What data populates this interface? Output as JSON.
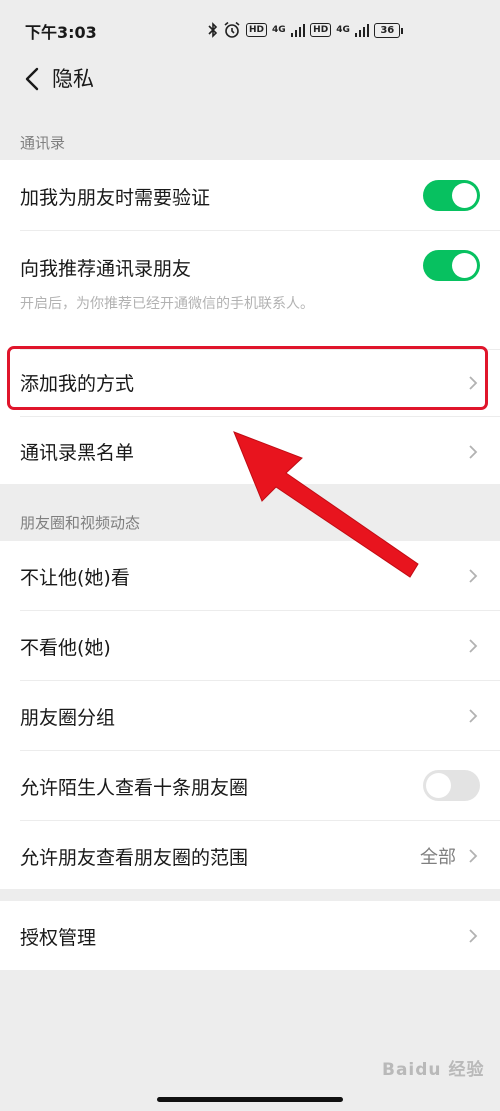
{
  "status_bar": {
    "time": "下午3:03",
    "hd1": "HD",
    "net1": "4G",
    "hd2": "HD",
    "net2": "4G",
    "battery": "36"
  },
  "nav": {
    "title": "隐私"
  },
  "sections": {
    "contacts": {
      "title": "通讯录"
    },
    "moments": {
      "title": "朋友圈和视频动态"
    }
  },
  "rows": {
    "verify": {
      "label": "加我为朋友时需要验证",
      "toggle_on": true
    },
    "recommend": {
      "label": "向我推荐通讯录朋友",
      "sub": "开启后，为你推荐已经开通微信的手机联系人。",
      "toggle_on": true
    },
    "add_methods": {
      "label": "添加我的方式"
    },
    "blacklist": {
      "label": "通讯录黑名单"
    },
    "hide_from": {
      "label": "不让他(她)看"
    },
    "dont_see": {
      "label": "不看他(她)"
    },
    "groups": {
      "label": "朋友圈分组"
    },
    "strangers": {
      "label": "允许陌生人查看十条朋友圈",
      "toggle_on": false
    },
    "range": {
      "label": "允许朋友查看朋友圈的范围",
      "value": "全部"
    },
    "auth": {
      "label": "授权管理"
    }
  },
  "watermark": "Baidu 经验",
  "colors": {
    "accent_green": "#07c160",
    "highlight_red": "#e0152b",
    "background": "#ededed"
  },
  "icons": {
    "back": "chevron-left-icon",
    "row_arrow": "chevron-right-icon",
    "annotation": "red-arrow-icon"
  }
}
